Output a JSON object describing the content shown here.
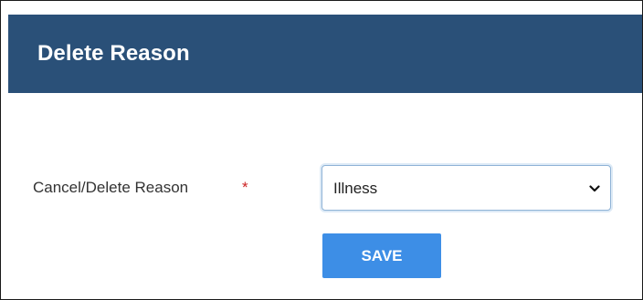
{
  "dialog": {
    "title": "Delete Reason",
    "header_color": "#2a5078"
  },
  "form": {
    "reason_label": "Cancel/Delete Reason",
    "required_marker": "*",
    "reason_selected": "Illness"
  },
  "actions": {
    "save_label": "SAVE",
    "save_color": "#3d8ee6"
  },
  "icons": {
    "select_arrow": "chevron-down-icon"
  }
}
